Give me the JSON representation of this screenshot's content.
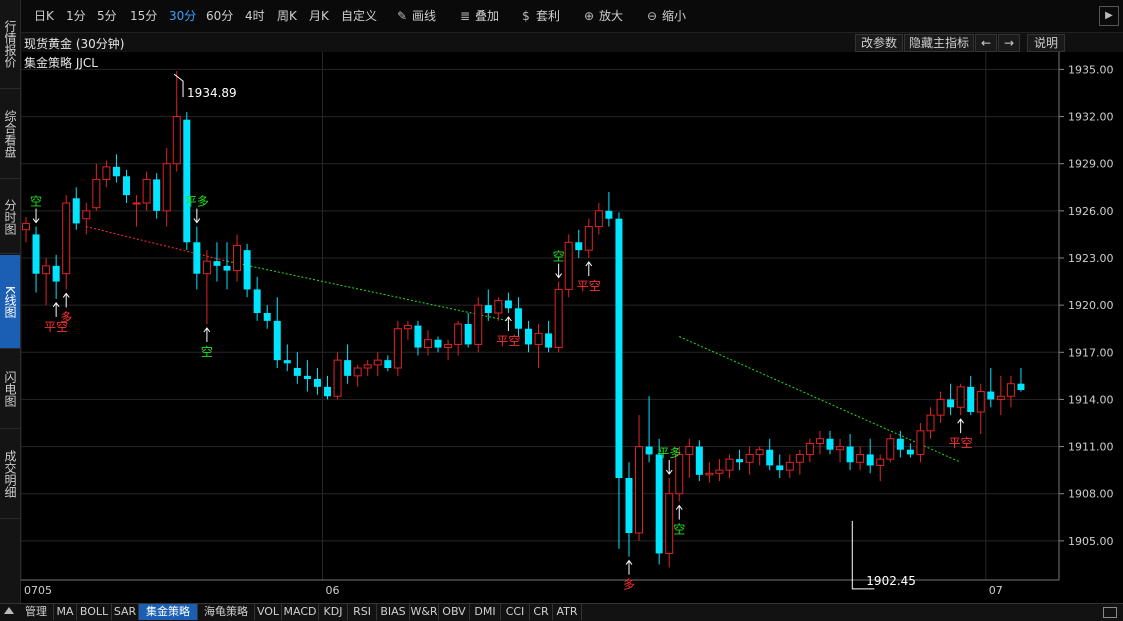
{
  "sidebar": {
    "items": [
      {
        "label": "行情报价",
        "active": false
      },
      {
        "label": "综合看盘",
        "active": false
      },
      {
        "label": "分时图",
        "active": false
      },
      {
        "label": "K线图",
        "active": true
      },
      {
        "label": "闪电图",
        "active": false
      },
      {
        "label": "成交明细",
        "active": false
      }
    ]
  },
  "toolbar": {
    "periods": [
      "日K",
      "1分",
      "5分",
      "15分",
      "30分",
      "60分",
      "4时",
      "周K",
      "月K",
      "自定义"
    ],
    "active_period": "30分",
    "tools": [
      {
        "label": "画线",
        "icon": "pencil-icon"
      },
      {
        "label": "叠加",
        "icon": "stack-icon"
      },
      {
        "label": "套利",
        "icon": "money-bag-icon"
      },
      {
        "label": "放大",
        "icon": "zoom-in-icon"
      },
      {
        "label": "缩小",
        "icon": "zoom-out-icon"
      }
    ]
  },
  "header": {
    "title": "现货黄金 (30分钟)",
    "buttons": {
      "modify": "改参数",
      "hide": "隐藏主指标",
      "left": "←",
      "right": "→",
      "help": "说明"
    }
  },
  "strategy_label": "集金策略 JJCL",
  "bottom_tabs": [
    "管理",
    "MA",
    "BOLL",
    "SAR",
    "集金策略",
    "海龟策略",
    "VOL",
    "MACD",
    "KDJ",
    "RSI",
    "BIAS",
    "W&R",
    "OBV",
    "DMI",
    "CCI",
    "CR",
    "ATR"
  ],
  "bottom_active": "集金策略",
  "colors": {
    "up": "#e02424",
    "down": "#00e5ff",
    "buy_signal": "#ff3030",
    "sell_signal": "#20e020",
    "arrow": "#ffffff",
    "grid": "#2a2a2a"
  },
  "chart_data": {
    "type": "candlestick",
    "title": "现货黄金 (30分钟)",
    "y_ticks": [
      "1935.00",
      "1932.00",
      "1929.00",
      "1926.00",
      "1923.00",
      "1920.00",
      "1917.00",
      "1914.00",
      "1911.00",
      "1908.00",
      "1905.00"
    ],
    "x_labels": [
      {
        "label": "0705",
        "index": 0
      },
      {
        "label": "06",
        "index": 30
      },
      {
        "label": "07",
        "index": 96
      }
    ],
    "ylim": [
      1902.5,
      1935.0
    ],
    "high_label": {
      "text": "1934.89",
      "index": 21,
      "value": 1934.89
    },
    "low_label": {
      "text": "1902.45",
      "index": 86,
      "value": 1902.45
    },
    "candles": [
      [
        1924.8,
        1925.6,
        1924.0,
        1925.2
      ],
      [
        1924.5,
        1925.0,
        1920.8,
        1922.0
      ],
      [
        1922.0,
        1923.0,
        1920.0,
        1922.5
      ],
      [
        1922.5,
        1923.2,
        1920.4,
        1921.5
      ],
      [
        1922.0,
        1927.0,
        1921.0,
        1926.5
      ],
      [
        1926.8,
        1927.5,
        1924.8,
        1925.2
      ],
      [
        1925.5,
        1926.5,
        1924.5,
        1926.0
      ],
      [
        1926.2,
        1929.0,
        1926.0,
        1928.0
      ],
      [
        1928.0,
        1929.2,
        1927.5,
        1928.8
      ],
      [
        1928.8,
        1929.6,
        1927.8,
        1928.2
      ],
      [
        1928.2,
        1928.6,
        1926.5,
        1927.0
      ],
      [
        1926.5,
        1927.0,
        1925.0,
        1926.5
      ],
      [
        1926.5,
        1928.5,
        1926.0,
        1928.0
      ],
      [
        1928.0,
        1928.4,
        1925.5,
        1926.0
      ],
      [
        1926.0,
        1930.0,
        1925.0,
        1929.0
      ],
      [
        1929.0,
        1934.89,
        1928.5,
        1932.0
      ],
      [
        1931.8,
        1932.3,
        1923.5,
        1924.0
      ],
      [
        1924.0,
        1925.0,
        1921.0,
        1922.0
      ],
      [
        1922.0,
        1923.5,
        1918.8,
        1922.8
      ],
      [
        1922.8,
        1924.0,
        1921.5,
        1922.5
      ],
      [
        1922.5,
        1924.0,
        1921.0,
        1922.2
      ],
      [
        1922.2,
        1924.5,
        1921.5,
        1923.8
      ],
      [
        1923.5,
        1923.9,
        1920.5,
        1921.0
      ],
      [
        1921.0,
        1921.8,
        1919.0,
        1919.5
      ],
      [
        1919.5,
        1920.0,
        1918.5,
        1919.0
      ],
      [
        1919.0,
        1920.5,
        1916.0,
        1916.5
      ],
      [
        1916.5,
        1917.5,
        1915.8,
        1916.3
      ],
      [
        1916.0,
        1917.0,
        1915.0,
        1915.5
      ],
      [
        1915.5,
        1916.5,
        1914.5,
        1915.3
      ],
      [
        1915.3,
        1916.0,
        1914.3,
        1914.8
      ],
      [
        1914.8,
        1915.5,
        1914.0,
        1914.2
      ],
      [
        1914.2,
        1917.0,
        1914.0,
        1916.5
      ],
      [
        1916.5,
        1917.5,
        1915.0,
        1915.5
      ],
      [
        1915.5,
        1916.2,
        1914.8,
        1916.0
      ],
      [
        1916.0,
        1916.5,
        1915.5,
        1916.2
      ],
      [
        1916.2,
        1917.0,
        1915.5,
        1916.5
      ],
      [
        1916.5,
        1916.8,
        1915.8,
        1916.0
      ],
      [
        1916.0,
        1919.0,
        1915.5,
        1918.5
      ],
      [
        1918.5,
        1919.0,
        1917.8,
        1918.7
      ],
      [
        1918.7,
        1919.0,
        1916.8,
        1917.3
      ],
      [
        1917.3,
        1918.4,
        1916.8,
        1917.8
      ],
      [
        1917.8,
        1918.0,
        1917.0,
        1917.3
      ],
      [
        1917.3,
        1917.8,
        1916.5,
        1917.5
      ],
      [
        1917.5,
        1919.0,
        1916.8,
        1918.8
      ],
      [
        1918.8,
        1919.5,
        1917.3,
        1917.5
      ],
      [
        1917.5,
        1920.5,
        1917.0,
        1920.0
      ],
      [
        1920.0,
        1921.0,
        1919.0,
        1919.5
      ],
      [
        1919.5,
        1920.5,
        1919.0,
        1920.3
      ],
      [
        1920.3,
        1920.8,
        1919.5,
        1919.8
      ],
      [
        1919.8,
        1920.5,
        1918.0,
        1918.5
      ],
      [
        1918.5,
        1919.0,
        1917.0,
        1917.5
      ],
      [
        1917.5,
        1918.8,
        1916.0,
        1918.2
      ],
      [
        1918.2,
        1919.0,
        1917.0,
        1917.3
      ],
      [
        1917.3,
        1921.5,
        1917.0,
        1921.0
      ],
      [
        1921.0,
        1924.5,
        1920.5,
        1924.0
      ],
      [
        1924.0,
        1924.8,
        1923.0,
        1923.5
      ],
      [
        1923.5,
        1925.5,
        1923.0,
        1925.0
      ],
      [
        1925.0,
        1926.5,
        1924.5,
        1926.0
      ],
      [
        1926.0,
        1927.2,
        1925.0,
        1925.5
      ],
      [
        1925.5,
        1925.9,
        1904.5,
        1909.0
      ],
      [
        1909.0,
        1910.0,
        1904.0,
        1905.5
      ],
      [
        1905.5,
        1913.0,
        1905.0,
        1911.0
      ],
      [
        1911.0,
        1914.2,
        1910.0,
        1910.5
      ],
      [
        1910.5,
        1911.5,
        1903.5,
        1904.2
      ],
      [
        1904.2,
        1909.0,
        1903.3,
        1908.0
      ],
      [
        1908.0,
        1911.0,
        1907.5,
        1910.5
      ],
      [
        1910.5,
        1911.5,
        1909.0,
        1911.0
      ],
      [
        1911.0,
        1911.4,
        1908.8,
        1909.2
      ],
      [
        1909.2,
        1910.0,
        1908.7,
        1909.3
      ],
      [
        1909.3,
        1910.2,
        1908.8,
        1909.5
      ],
      [
        1909.5,
        1910.5,
        1909.0,
        1910.2
      ],
      [
        1910.2,
        1910.8,
        1909.5,
        1910.0
      ],
      [
        1910.0,
        1911.0,
        1909.2,
        1910.5
      ],
      [
        1910.5,
        1911.0,
        1909.8,
        1910.8
      ],
      [
        1910.8,
        1911.5,
        1909.5,
        1909.8
      ],
      [
        1909.8,
        1910.5,
        1909.0,
        1909.5
      ],
      [
        1909.5,
        1910.5,
        1909.0,
        1910.0
      ],
      [
        1910.0,
        1910.8,
        1909.2,
        1910.5
      ],
      [
        1910.5,
        1911.5,
        1910.0,
        1911.2
      ],
      [
        1911.2,
        1912.0,
        1910.5,
        1911.5
      ],
      [
        1911.5,
        1912.0,
        1910.5,
        1910.8
      ],
      [
        1910.8,
        1911.5,
        1910.0,
        1911.0
      ],
      [
        1911.0,
        1911.8,
        1909.5,
        1910.0
      ],
      [
        1910.0,
        1911.0,
        1909.5,
        1910.5
      ],
      [
        1910.5,
        1911.5,
        1909.3,
        1909.8
      ],
      [
        1909.8,
        1910.5,
        1908.8,
        1910.2
      ],
      [
        1910.2,
        1911.8,
        1910.0,
        1911.5
      ],
      [
        1911.5,
        1912.0,
        1910.3,
        1910.8
      ],
      [
        1910.8,
        1911.2,
        1910.3,
        1910.5
      ],
      [
        1910.5,
        1912.5,
        1910.0,
        1912.0
      ],
      [
        1912.0,
        1913.5,
        1911.5,
        1913.0
      ],
      [
        1913.0,
        1914.5,
        1912.5,
        1914.0
      ],
      [
        1914.0,
        1915.0,
        1913.0,
        1913.5
      ],
      [
        1913.5,
        1915.0,
        1913.0,
        1914.8
      ],
      [
        1914.8,
        1915.5,
        1913.0,
        1913.2
      ],
      [
        1913.2,
        1915.0,
        1911.8,
        1914.5
      ],
      [
        1914.5,
        1916.0,
        1913.5,
        1914.0
      ],
      [
        1914.0,
        1915.5,
        1913.0,
        1914.2
      ],
      [
        1914.2,
        1915.5,
        1913.5,
        1915.0
      ],
      [
        1915.0,
        1916.0,
        1914.5,
        1914.6
      ]
    ],
    "signals": [
      {
        "text": "空",
        "index": 1,
        "kind": "sell",
        "pos": "above"
      },
      {
        "text": "平空",
        "index": 3,
        "kind": "buy",
        "pos": "below"
      },
      {
        "text": "多",
        "index": 4,
        "kind": "buy",
        "pos": "below"
      },
      {
        "text": "平多",
        "index": 17,
        "kind": "sell",
        "pos": "above"
      },
      {
        "text": "空",
        "index": 18,
        "kind": "sell",
        "pos": "below_up"
      },
      {
        "text": "平空",
        "index": 48,
        "kind": "buy",
        "pos": "below"
      },
      {
        "text": "空",
        "index": 53,
        "kind": "sell",
        "pos": "above"
      },
      {
        "text": "平空",
        "index": 56,
        "kind": "buy",
        "pos": "below"
      },
      {
        "text": "多",
        "index": 60,
        "kind": "buy",
        "pos": "below"
      },
      {
        "text": "平多",
        "index": 64,
        "kind": "sell",
        "pos": "above"
      },
      {
        "text": "空",
        "index": 65,
        "kind": "sell",
        "pos": "below_up"
      },
      {
        "text": "平空",
        "index": 93,
        "kind": "buy",
        "pos": "below"
      }
    ],
    "trend_lines": [
      {
        "from": [
          6,
          1925.0
        ],
        "to": [
          20,
          1922.8
        ],
        "color": "#ff3030"
      },
      {
        "from": [
          20,
          1922.8
        ],
        "to": [
          48,
          1919.0
        ],
        "color": "#20e020"
      },
      {
        "from": [
          65,
          1918.0
        ],
        "to": [
          93,
          1910.0
        ],
        "color": "#20e020"
      }
    ]
  }
}
